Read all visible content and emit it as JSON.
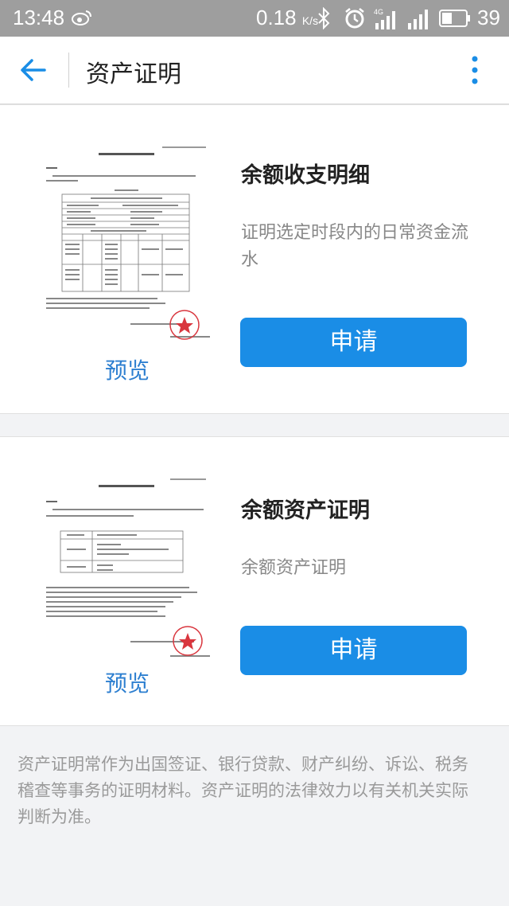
{
  "status_bar": {
    "time": "13:48",
    "net_speed": "0.18",
    "net_speed_unit": "K/s",
    "signal_label": "4G",
    "battery": "39"
  },
  "header": {
    "title": "资产证明"
  },
  "cards": [
    {
      "title": "余额收支明细",
      "description": "证明选定时段内的日常资金流水",
      "apply_label": "申请",
      "preview_label": "预览"
    },
    {
      "title": "余额资产证明",
      "description": "余额资产证明",
      "apply_label": "申请",
      "preview_label": "预览"
    }
  ],
  "footnote": "资产证明常作为出国签证、银行贷款、财产纠纷、诉讼、税务稽查等事务的证明材料。资产证明的法律效力以有关机关实际判断为准。",
  "colors": {
    "accent": "#1a8de6",
    "link": "#2d7fd0",
    "stamp": "#d9363e"
  }
}
